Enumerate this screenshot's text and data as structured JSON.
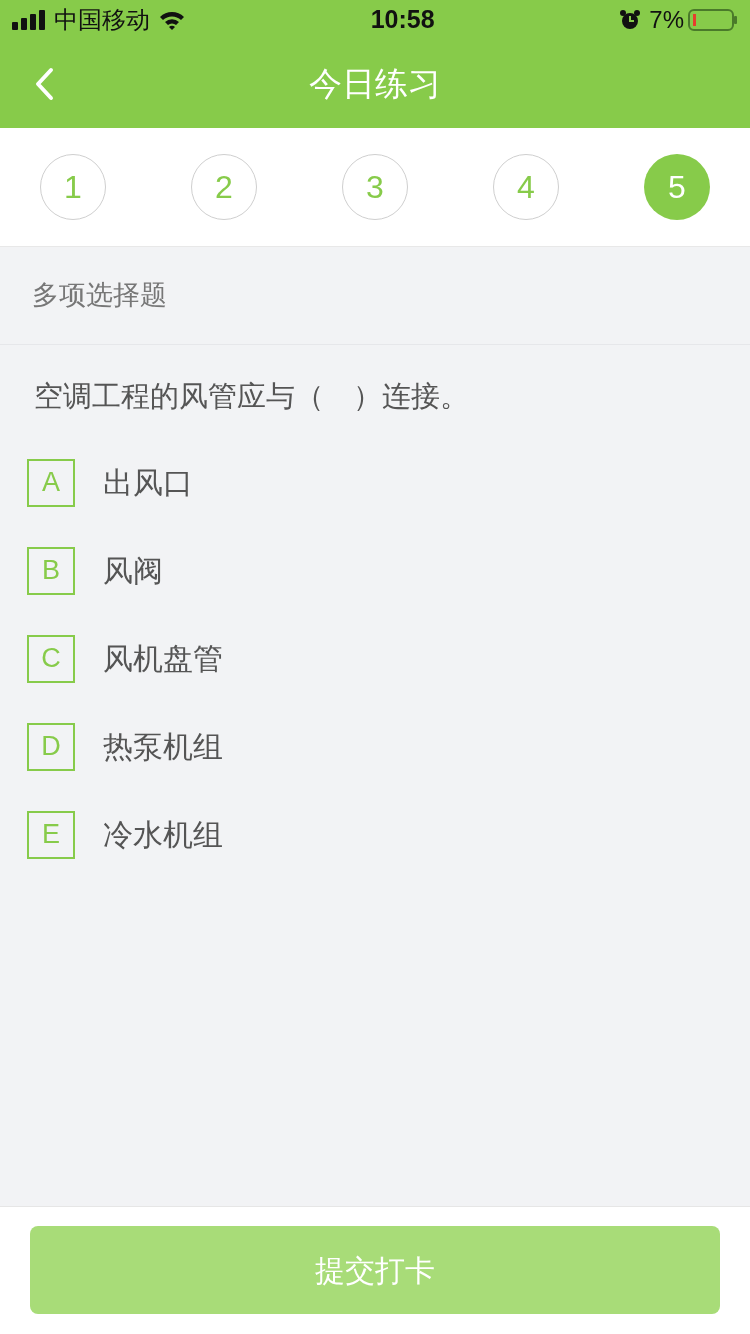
{
  "status_bar": {
    "carrier": "中国移动",
    "time": "10:58",
    "battery": "7%"
  },
  "nav": {
    "title": "今日练习"
  },
  "steps": [
    {
      "label": "1",
      "selected": false
    },
    {
      "label": "2",
      "selected": false
    },
    {
      "label": "3",
      "selected": false
    },
    {
      "label": "4",
      "selected": false
    },
    {
      "label": "5",
      "selected": true
    }
  ],
  "question_type": "多项选择题",
  "question": "空调工程的风管应与（　）连接。",
  "options": [
    {
      "letter": "A",
      "text": "出风口",
      "selected": false
    },
    {
      "letter": "B",
      "text": "风阀",
      "selected": false
    },
    {
      "letter": "C",
      "text": "风机盘管",
      "selected": false
    },
    {
      "letter": "D",
      "text": "热泵机组",
      "selected": false
    },
    {
      "letter": "E",
      "text": "冷水机组",
      "selected": false
    }
  ],
  "submit": {
    "label": "提交打卡",
    "disabled": true
  }
}
